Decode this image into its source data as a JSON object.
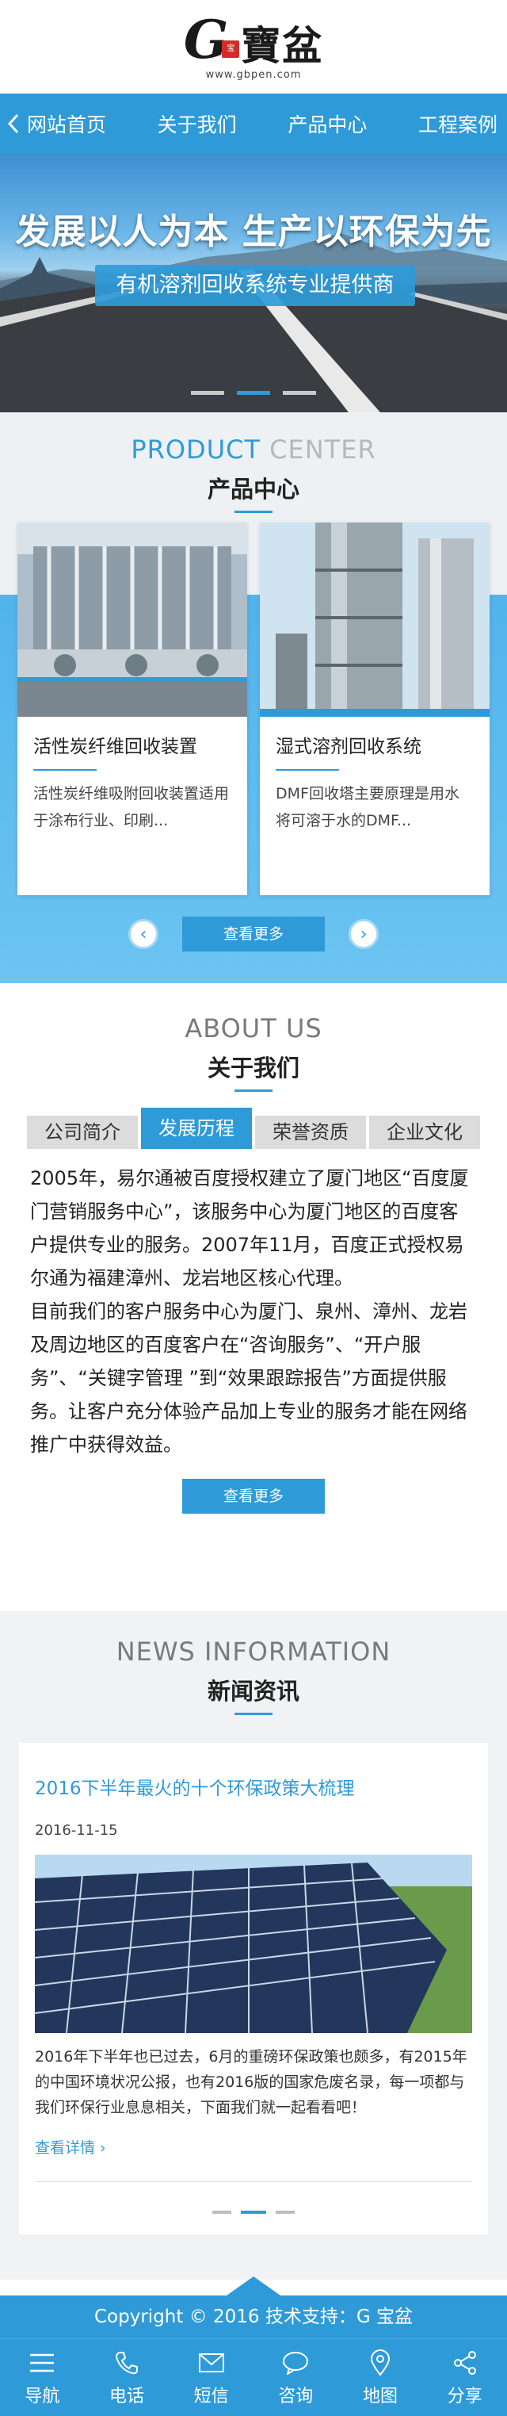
{
  "header": {
    "logo_letter": "G",
    "logo_seal": "宝",
    "logo_text": "寶盆",
    "logo_url": "www.gbpen.com"
  },
  "nav": {
    "items": [
      "网站首页",
      "关于我们",
      "产品中心",
      "工程案例"
    ]
  },
  "banner": {
    "title": "发展以人为本  生产以环保为先",
    "subtitle": "有机溶剂回收系统专业提供商",
    "slide_count": 3,
    "active_slide": 2
  },
  "product": {
    "heading_en_1": "PRODUCT",
    "heading_en_2": "CENTER",
    "heading_cn": "产品中心",
    "items": [
      {
        "title": "活性炭纤维回收装置",
        "desc": "活性炭纤维吸附回收装置适用于涂布行业、印刷..."
      },
      {
        "title": "湿式溶剂回收系统",
        "desc": "DMF回收塔主要原理是用水将可溶于水的DMF..."
      }
    ],
    "prev_label": "‹",
    "next_label": "›",
    "more_label": "查看更多"
  },
  "about": {
    "heading_en": "ABOUT US",
    "heading_cn": "关于我们",
    "tabs": [
      "公司简介",
      "发展历程",
      "荣誉资质",
      "企业文化"
    ],
    "active_tab": 1,
    "paragraph_1": "2005年，易尔通被百度授权建立了厦门地区“百度厦门营销服务中心”，该服务中心为厦门地区的百度客户提供专业的服务。2007年11月，百度正式授权易尔通为福建漳州、龙岩地区核心代理。",
    "paragraph_2": "目前我们的客户服务中心为厦门、泉州、漳州、龙岩及周边地区的百度客户在“咨询服务”、“开户服务”、“关键字管理 ”到“效果跟踪报告”方面提供服务。让客户充分体验产品加上专业的服务才能在网络推广中获得效益。",
    "more_label": "查看更多"
  },
  "news": {
    "heading_en": "NEWS INFORMATION",
    "heading_cn": "新闻资讯",
    "title": "2016下半年最火的十个环保政策大梳理",
    "date": "2016-11-15",
    "desc": "2016年下半年也已过去，6月的重磅环保政策也颇多，有2015年的中国环境状况公报，也有2016版的国家危废名录，每一项都与我们环保行业息息相关，下面我们就一起看看吧！",
    "link_label": "查看详情 ›",
    "slide_count": 3,
    "active_slide": 1
  },
  "footer": {
    "copyright": "Copyright © 2016  技术支持：G 宝盆"
  },
  "bottom_bar": {
    "items": [
      {
        "label": "导航",
        "icon": "menu-icon"
      },
      {
        "label": "电话",
        "icon": "phone-icon"
      },
      {
        "label": "短信",
        "icon": "mail-icon"
      },
      {
        "label": "咨询",
        "icon": "chat-icon"
      },
      {
        "label": "地图",
        "icon": "map-pin-icon"
      },
      {
        "label": "分享",
        "icon": "share-icon"
      }
    ]
  },
  "colors": {
    "accent": "#2f9ad8",
    "tab_inactive": "#dcdcdc",
    "background_gray": "#f0f2f3"
  }
}
